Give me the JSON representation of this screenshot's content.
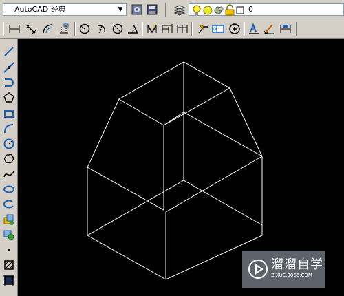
{
  "workspace": {
    "value": "AutoCAD 经典"
  },
  "layer": {
    "current": "0"
  },
  "toolbars": {
    "workspace": [
      "workspace-settings-icon",
      "save-workspace-icon"
    ],
    "layer": [
      "layer-manager-icon",
      "light-bulb-icon",
      "sun-icon",
      "layer-state-icon",
      "lock-icon",
      "color-swatch-icon"
    ],
    "dimension": [
      "linear-dimension-icon",
      "aligned-dimension-icon",
      "arc-length-icon",
      "ordinate-dimension-icon",
      "radius-dimension-icon",
      "jogged-dimension-icon",
      "diameter-dimension-icon",
      "angular-dimension-icon",
      "quick-dimension-icon",
      "baseline-dimension-icon",
      "continue-dimension-icon",
      "quick-leader-icon",
      "tolerance-icon",
      "center-mark-icon",
      "dimension-edit-icon",
      "dimension-text-edit-icon",
      "dimension-update-icon"
    ],
    "draw": [
      "line-icon",
      "construction-line-icon",
      "polyline-icon",
      "polygon-icon",
      "rectangle-icon",
      "arc-icon",
      "circle-icon",
      "revision-cloud-icon",
      "spline-icon",
      "ellipse-icon",
      "ellipse-arc-icon",
      "insert-block-icon",
      "make-block-icon",
      "point-icon",
      "hatch-icon",
      "gradient-icon"
    ]
  },
  "watermark": {
    "title": "溜溜自学",
    "url": "ZIXUE.3066.COM"
  },
  "colors": {
    "canvas": "#000000",
    "wireframe": "#ffffff",
    "toolbar": "#d4d0c8"
  }
}
